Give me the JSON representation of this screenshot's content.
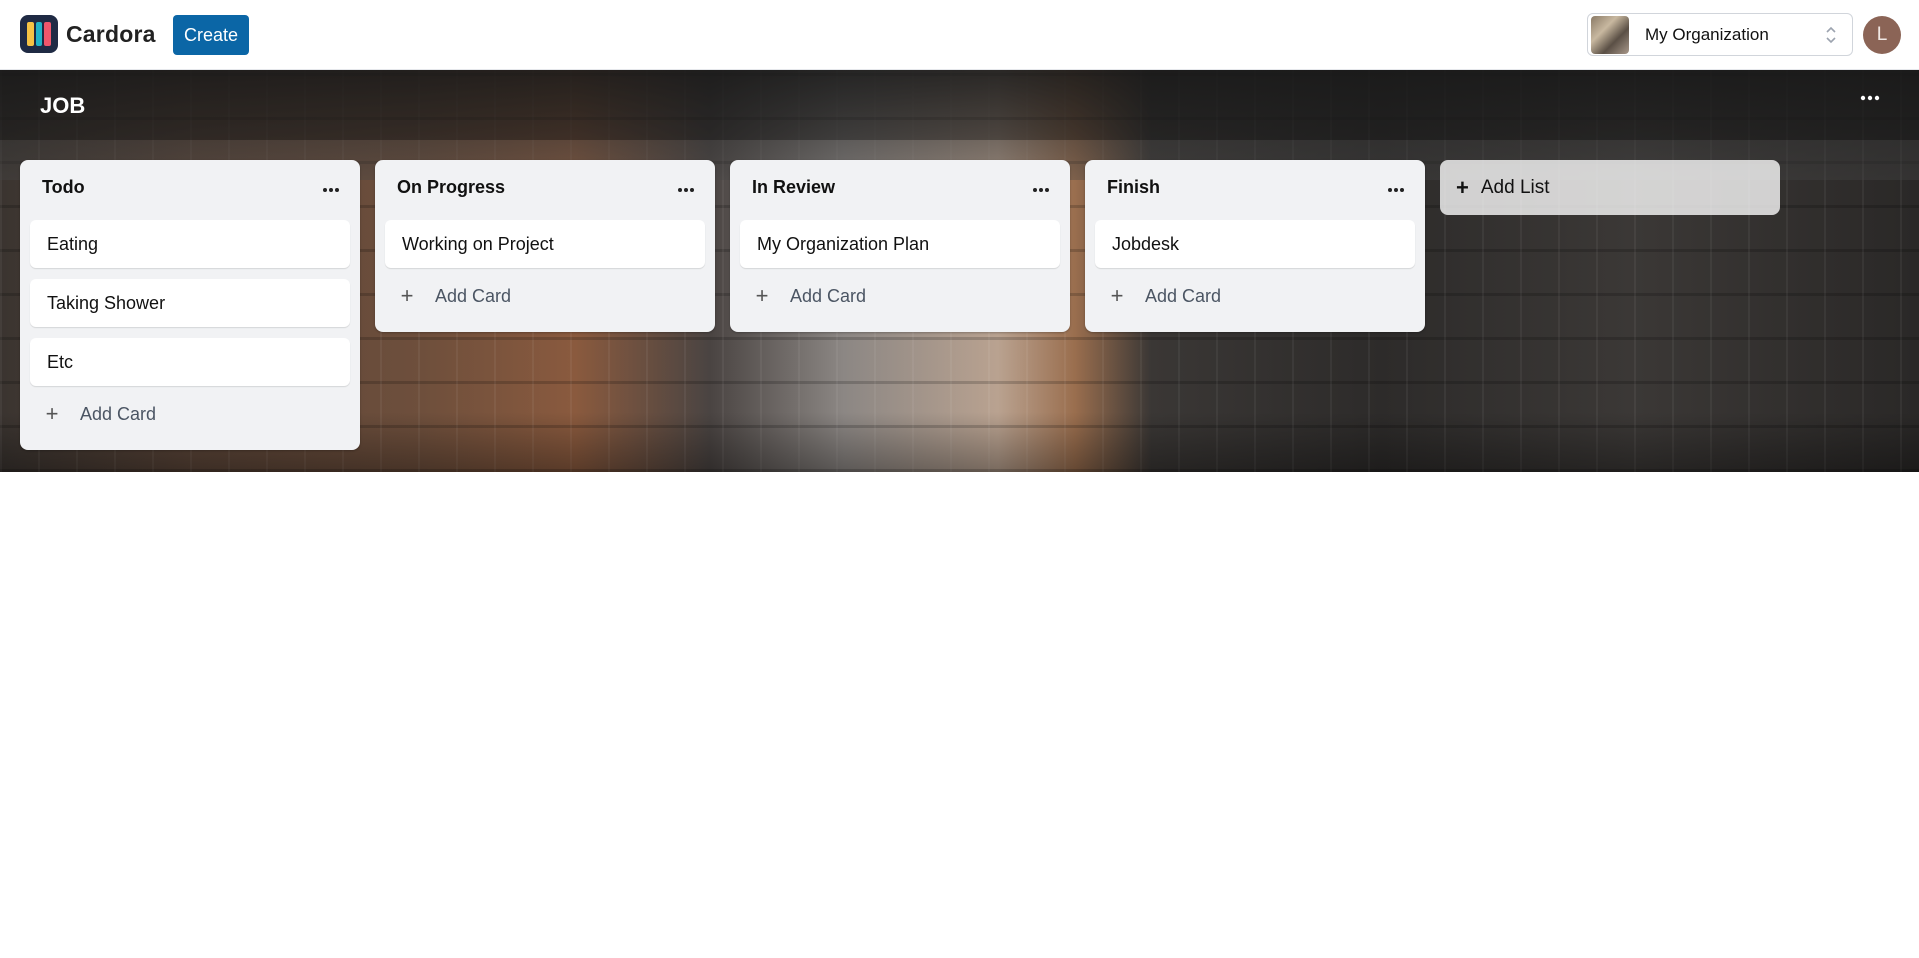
{
  "app": {
    "name": "Cardora",
    "create_label": "Create"
  },
  "org": {
    "name": "My Organization"
  },
  "user": {
    "initial": "L"
  },
  "board": {
    "title": "JOB",
    "more_label": "…",
    "add_list_label": "Add List",
    "lists": [
      {
        "title": "Todo",
        "cards": [
          "Eating",
          "Taking Shower",
          "Etc"
        ],
        "add_label": "Add Card"
      },
      {
        "title": "On Progress",
        "cards": [
          "Working on Project"
        ],
        "add_label": "Add Card"
      },
      {
        "title": "In Review",
        "cards": [
          "My Organization Plan"
        ],
        "add_label": "Add Card"
      },
      {
        "title": "Finish",
        "cards": [
          "Jobdesk"
        ],
        "add_label": "Add Card"
      }
    ]
  },
  "icons": {
    "list_more": "more-horizontal-icon",
    "add": "plus-icon",
    "org_chevron": "chevron-up-down-icon"
  },
  "colors": {
    "primary": "#0b66a6",
    "list_bg": "#f1f2f4",
    "avatar": "#8b6456"
  }
}
